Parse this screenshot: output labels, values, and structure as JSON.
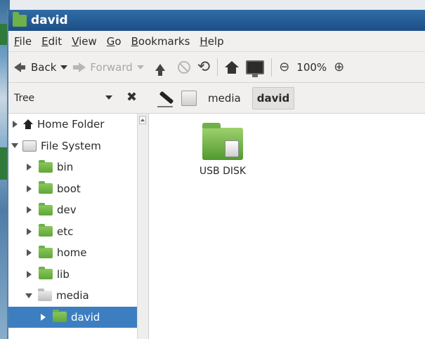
{
  "window": {
    "title": "david"
  },
  "menubar": [
    "File",
    "Edit",
    "View",
    "Go",
    "Bookmarks",
    "Help"
  ],
  "toolbar": {
    "back_label": "Back",
    "forward_label": "Forward",
    "zoom_text": "100%"
  },
  "side_pane": {
    "mode": "Tree",
    "close_glyph": "✖"
  },
  "location": {
    "crumbs": [
      "media",
      "david"
    ],
    "active": "david"
  },
  "tree": [
    {
      "label": "Home Folder",
      "icon": "home-icon",
      "expanded": false,
      "level": 0
    },
    {
      "label": "File System",
      "icon": "filesystem-icon",
      "expanded": true,
      "level": 0
    },
    {
      "label": "bin",
      "icon": "folder-icon",
      "expanded": false,
      "level": 1
    },
    {
      "label": "boot",
      "icon": "folder-icon",
      "expanded": false,
      "level": 1
    },
    {
      "label": "dev",
      "icon": "folder-icon",
      "expanded": false,
      "level": 1
    },
    {
      "label": "etc",
      "icon": "folder-icon",
      "expanded": false,
      "level": 1
    },
    {
      "label": "home",
      "icon": "folder-icon",
      "expanded": false,
      "level": 1
    },
    {
      "label": "lib",
      "icon": "folder-icon",
      "expanded": false,
      "level": 1
    },
    {
      "label": "media",
      "icon": "folder-open-icon",
      "expanded": true,
      "level": 1
    },
    {
      "label": "david",
      "icon": "folder-icon",
      "expanded": false,
      "level": 2,
      "selected": true
    }
  ],
  "content": {
    "items": [
      {
        "label": "USB DISK",
        "icon": "usb-disk-folder-icon"
      }
    ]
  },
  "colors": {
    "titlebar": "#1d4f86",
    "folder": "#6fb04a",
    "selection": "#3d7ec1"
  }
}
